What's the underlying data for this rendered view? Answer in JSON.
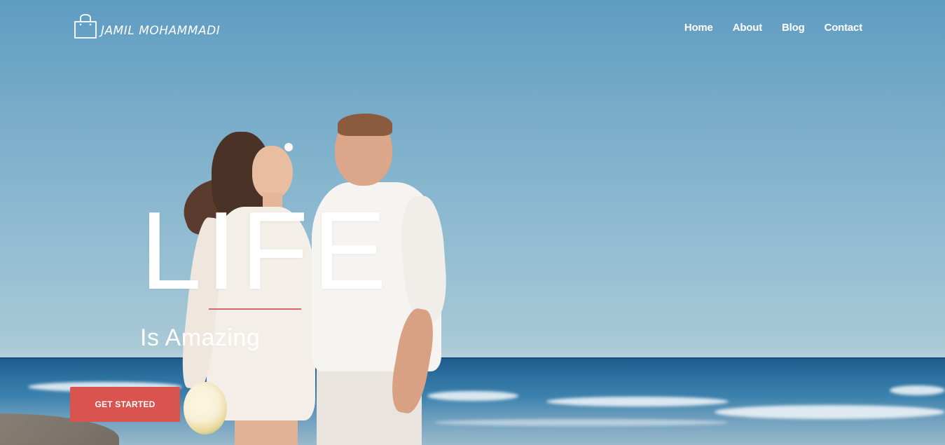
{
  "brand": {
    "name": "JAMIL MOHAMMADI",
    "icon": "shopping-bag-icon"
  },
  "nav": {
    "items": [
      {
        "label": "Home"
      },
      {
        "label": "About"
      },
      {
        "label": "Blog"
      },
      {
        "label": "Contact"
      }
    ]
  },
  "hero": {
    "title": "LIFE",
    "subtitle": "Is Amazing",
    "cta_label": "GET STARTED"
  },
  "colors": {
    "accent": "#d9534f",
    "divider": "#d66a6a",
    "text": "#ffffff"
  }
}
